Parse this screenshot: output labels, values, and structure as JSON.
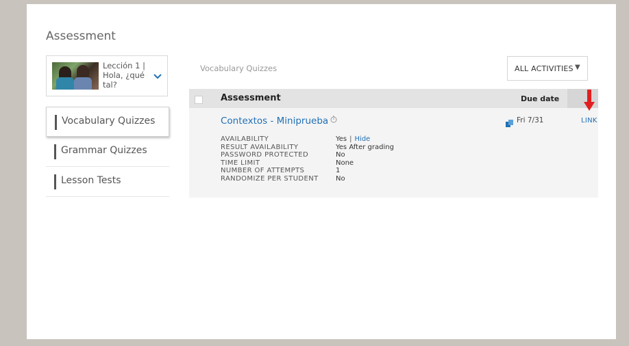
{
  "page": {
    "title": "Assessment"
  },
  "lesson": {
    "title": "Lección 1 | Hola, ¿qué tal?"
  },
  "sidebar": {
    "items": [
      {
        "label": "Vocabulary Quizzes",
        "active": true
      },
      {
        "label": "Grammar Quizzes",
        "active": false
      },
      {
        "label": "Lesson Tests",
        "active": false
      }
    ]
  },
  "main": {
    "breadcrumb": "Vocabulary Quizzes",
    "filter": {
      "selected": "ALL ACTIVITIES"
    },
    "table": {
      "headers": {
        "assessment": "Assessment",
        "due": "Due date"
      },
      "row": {
        "title": "Contextos - Miniprueba",
        "due_date": "Fri 7/31",
        "link_label": "LINK",
        "properties": [
          {
            "key": "AVAILABILITY",
            "value": "Yes"
          },
          {
            "key": "RESULT AVAILABILITY",
            "value": "Yes After grading"
          },
          {
            "key": "PASSWORD PROTECTED",
            "value": "No"
          },
          {
            "key": "TIME LIMIT",
            "value": "None"
          },
          {
            "key": "NUMBER OF ATTEMPTS",
            "value": "1"
          },
          {
            "key": "RANDOMIZE PER STUDENT",
            "value": "No"
          }
        ],
        "availability_separator": "|",
        "hide_label": "Hide"
      }
    }
  },
  "colors": {
    "link": "#1f6fb5",
    "arrow": "#e02020",
    "frame": "#c9c3bd"
  },
  "icons": {
    "lesson_chevron": "chevron-down-icon",
    "filter_caret": "caret-down-icon",
    "timer": "timer-icon",
    "due": "calendar-icon",
    "annotation": "red-arrow-icon"
  }
}
